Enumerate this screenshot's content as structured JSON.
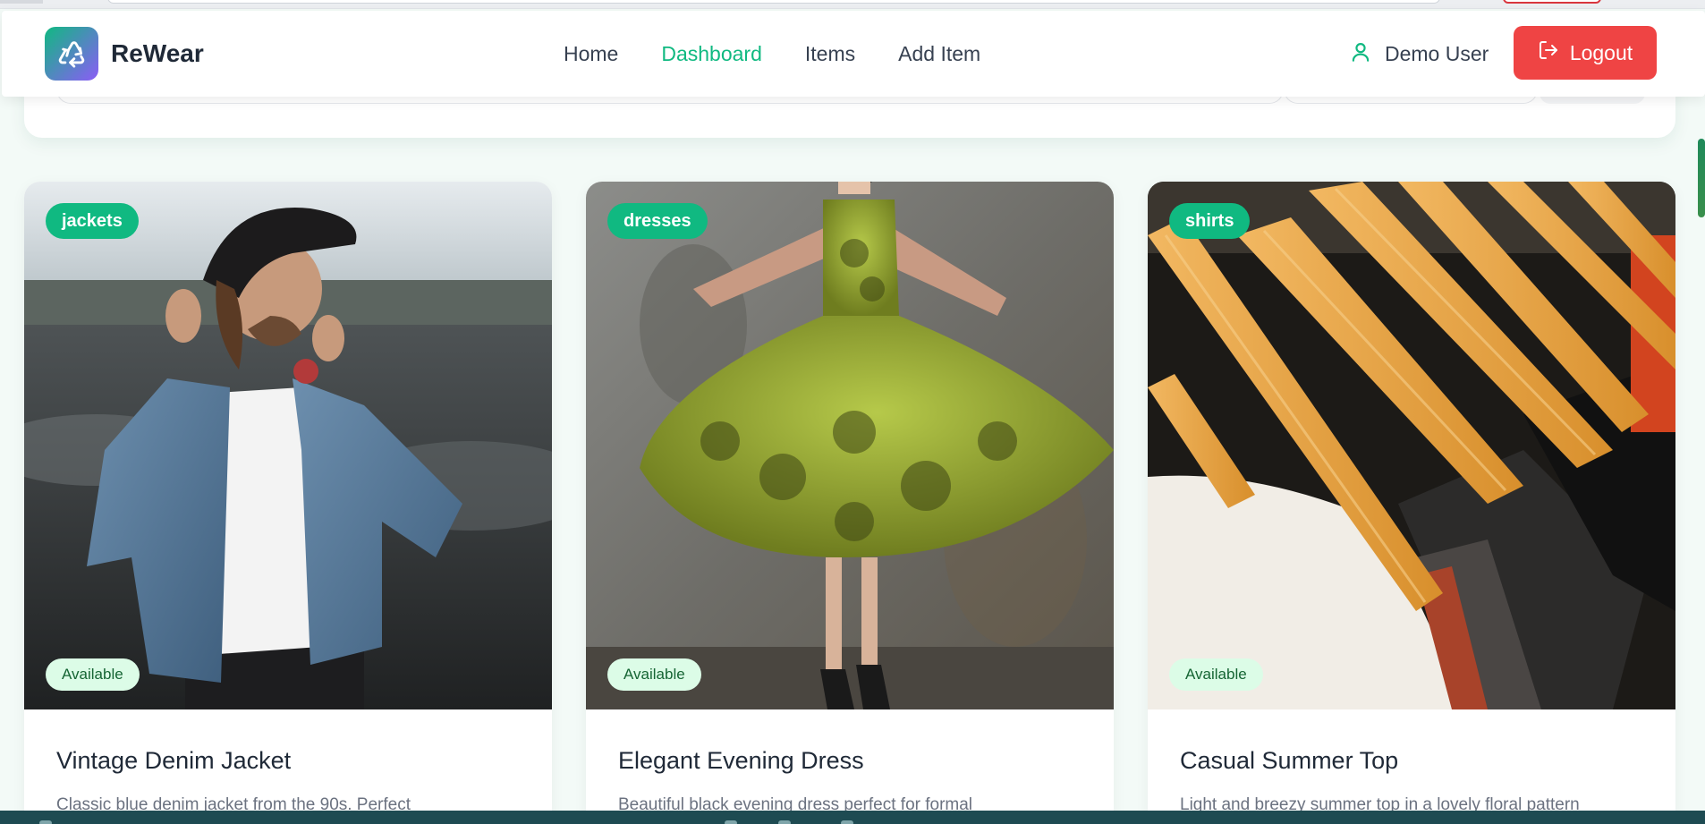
{
  "header": {
    "brand_name": "ReWear",
    "brand_icon": "recycle-icon",
    "nav": [
      {
        "label": "Home",
        "active": false
      },
      {
        "label": "Dashboard",
        "active": true
      },
      {
        "label": "Items",
        "active": false
      },
      {
        "label": "Add Item",
        "active": false
      }
    ],
    "user_name": "Demo User",
    "user_icon": "user-icon",
    "logout_label": "Logout",
    "logout_icon": "logout-icon"
  },
  "colors": {
    "accent": "#10b981",
    "danger": "#ef4444",
    "status_bg": "#dcfce7",
    "status_text": "#166534"
  },
  "items": [
    {
      "category": "jackets",
      "status": "Available",
      "title": "Vintage Denim Jacket",
      "description": "Classic blue denim jacket from the 90s. Perfect"
    },
    {
      "category": "dresses",
      "status": "Available",
      "title": "Elegant Evening Dress",
      "description": "Beautiful black evening dress perfect for formal"
    },
    {
      "category": "shirts",
      "status": "Available",
      "title": "Casual Summer Top",
      "description": "Light and breezy summer top in a lovely floral pattern"
    }
  ]
}
